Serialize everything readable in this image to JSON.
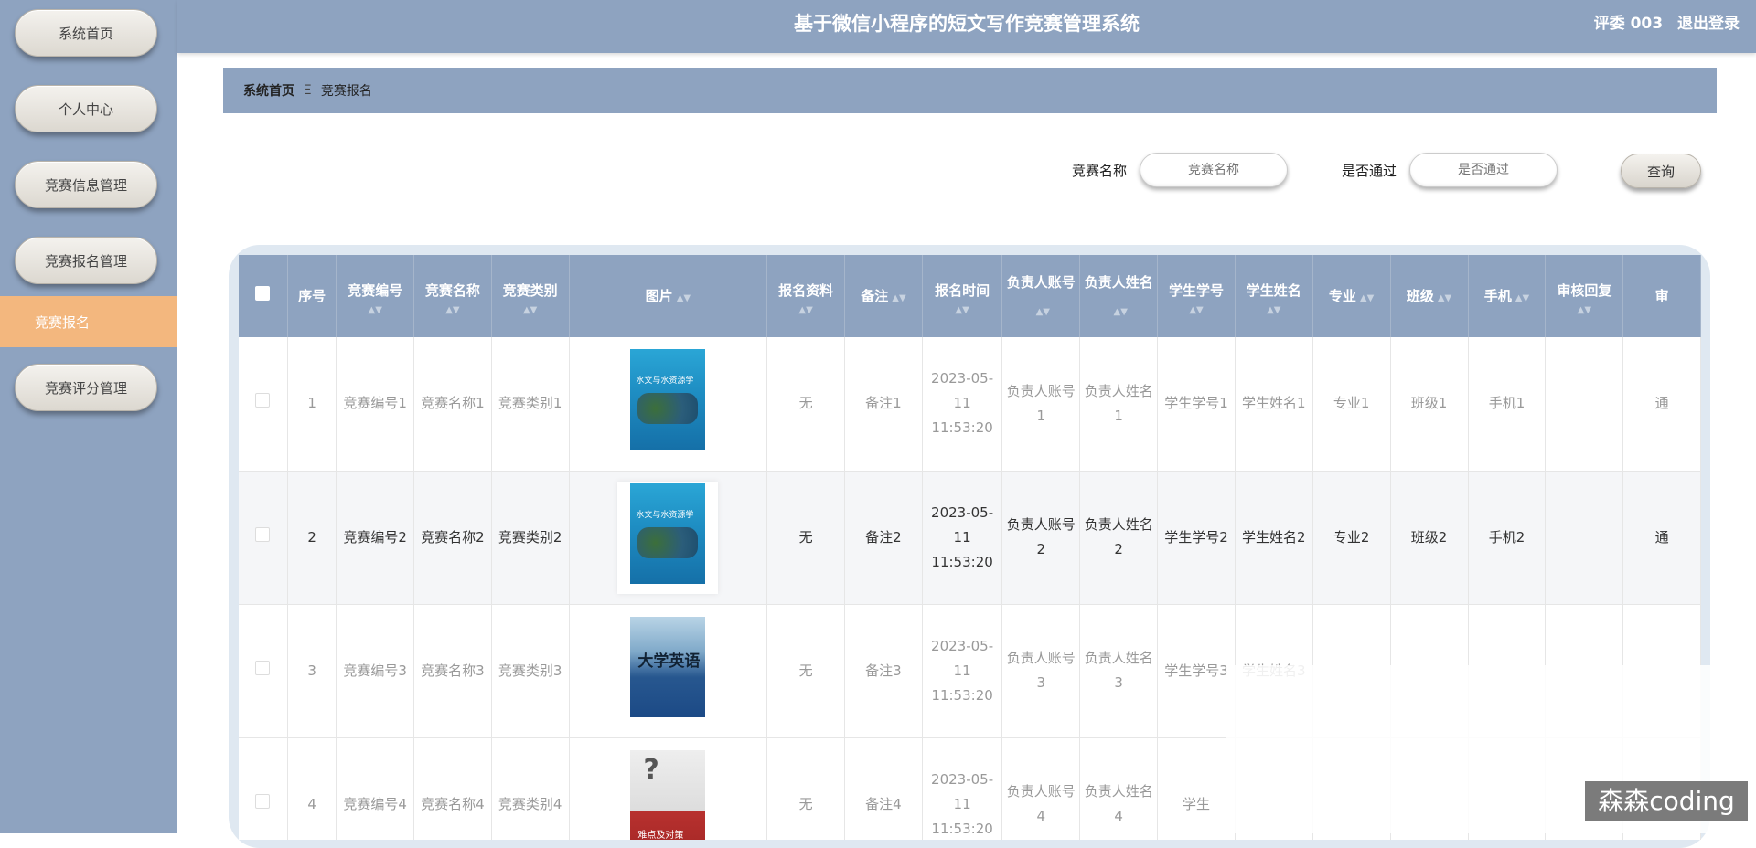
{
  "header": {
    "title": "基于微信小程序的短文写作竞赛管理系统",
    "user": "评委 003",
    "logout": "退出登录"
  },
  "sidebar": {
    "items": [
      {
        "label": "系统首页"
      },
      {
        "label": "个人中心"
      },
      {
        "label": "竞赛信息管理"
      },
      {
        "label": "竞赛报名管理"
      },
      {
        "label": "竞赛报名",
        "active": true
      },
      {
        "label": "竞赛评分管理"
      }
    ]
  },
  "breadcrumb": {
    "home": "系统首页",
    "separator": "Ξ",
    "current": "竞赛报名"
  },
  "search": {
    "name_label": "竞赛名称",
    "name_placeholder": "竞赛名称",
    "pass_label": "是否通过",
    "pass_placeholder": "是否通过",
    "query_button": "查询"
  },
  "table": {
    "columns": [
      "序号",
      "竞赛编号",
      "竞赛名称",
      "竞赛类别",
      "图片",
      "报名资料",
      "备注",
      "报名时间",
      "负责人账号",
      "负责人姓名",
      "学生学号",
      "学生姓名",
      "专业",
      "班级",
      "手机",
      "审核回复",
      "审"
    ],
    "rows": [
      {
        "seq": "1",
        "code": "竞赛编号1",
        "name": "竞赛名称1",
        "cat": "竞赛类别1",
        "image": "水文与水资源学",
        "material": "无",
        "note": "备注1",
        "time": "2023-05-11 11:53:20",
        "acct": "负责人账号1",
        "mgr": "负责人姓名1",
        "sid": "学生学号1",
        "sname": "学生姓名1",
        "major": "专业1",
        "cls": "班级1",
        "phone": "手机1",
        "reply": "",
        "status": "通"
      },
      {
        "seq": "2",
        "code": "竞赛编号2",
        "name": "竞赛名称2",
        "cat": "竞赛类别2",
        "image": "水文与水资源学",
        "material": "无",
        "note": "备注2",
        "time": "2023-05-11 11:53:20",
        "acct": "负责人账号2",
        "mgr": "负责人姓名2",
        "sid": "学生学号2",
        "sname": "学生姓名2",
        "major": "专业2",
        "cls": "班级2",
        "phone": "手机2",
        "reply": "",
        "status": "通"
      },
      {
        "seq": "3",
        "code": "竞赛编号3",
        "name": "竞赛名称3",
        "cat": "竞赛类别3",
        "image": "大学英语",
        "material": "无",
        "note": "备注3",
        "time": "2023-05-11 11:53:20",
        "acct": "负责人账号3",
        "mgr": "负责人姓名3",
        "sid": "学生学号3",
        "sname": "学生姓名3",
        "major": "",
        "cls": "",
        "phone": "",
        "reply": "",
        "status": ""
      },
      {
        "seq": "4",
        "code": "竞赛编号4",
        "name": "竞赛名称4",
        "cat": "竞赛类别4",
        "image": "难点及对策",
        "material": "无",
        "note": "备注4",
        "time": "2023-05-11 11:53:20",
        "acct": "负责人账号4",
        "mgr": "负责人姓名4",
        "sid": "学生",
        "sname": "",
        "major": "",
        "cls": "",
        "phone": "",
        "reply": "",
        "status": ""
      }
    ]
  },
  "watermark": "森森coding"
}
